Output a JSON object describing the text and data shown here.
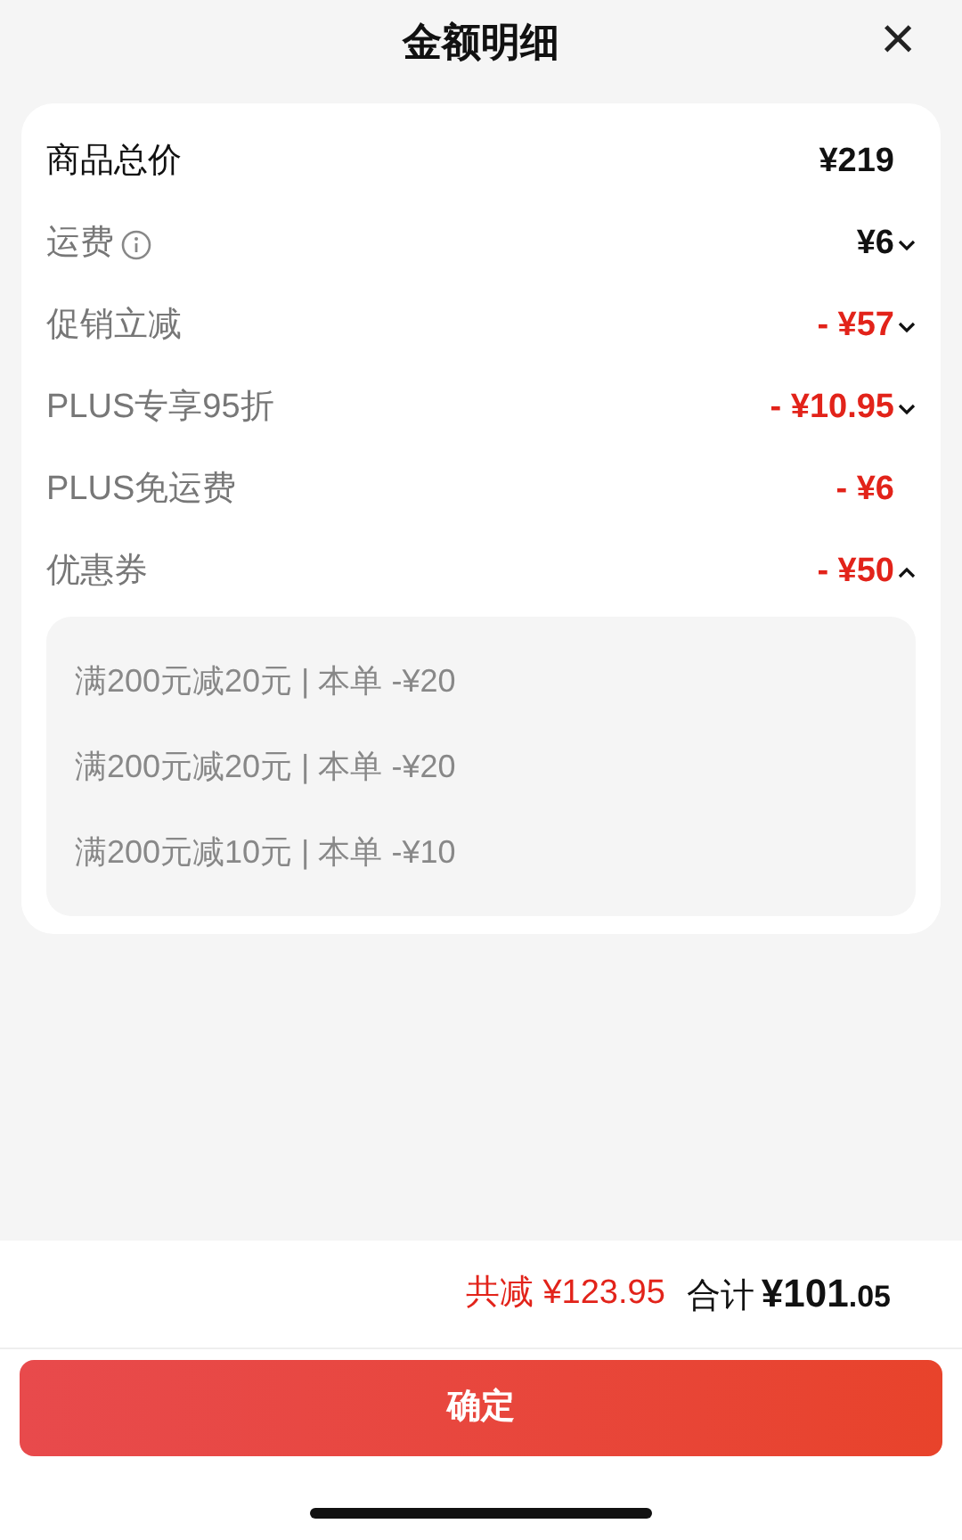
{
  "header": {
    "title": "金额明细",
    "close": "×"
  },
  "rows": [
    {
      "kind": "header",
      "label": "商品总价",
      "value": "¥219",
      "discount": false,
      "info": false,
      "expandable": false
    },
    {
      "kind": "item",
      "label": "运费",
      "value": "¥6",
      "discount": false,
      "info": true,
      "expandable": true,
      "expanded": false
    },
    {
      "kind": "item",
      "label": "促销立减",
      "value": "- ¥57",
      "discount": true,
      "info": false,
      "expandable": true,
      "expanded": false
    },
    {
      "kind": "item",
      "label": "PLUS专享95折",
      "value": "- ¥10.95",
      "discount": true,
      "info": false,
      "expandable": true,
      "expanded": false
    },
    {
      "kind": "item",
      "label": "PLUS免运费",
      "value": "- ¥6",
      "discount": true,
      "info": false,
      "expandable": false
    },
    {
      "kind": "item",
      "label": "优惠券",
      "value": "- ¥50",
      "discount": true,
      "info": false,
      "expandable": true,
      "expanded": true
    }
  ],
  "coupons": [
    "满200元减20元 | 本单 -¥20",
    "满200元减20元 | 本单 -¥20",
    "满200元减10元 | 本单 -¥10"
  ],
  "footer": {
    "saved": "共减 ¥123.95",
    "total_label": "合计",
    "total_main": "¥101",
    "total_decimal": ".05"
  },
  "confirm_button": "确定"
}
